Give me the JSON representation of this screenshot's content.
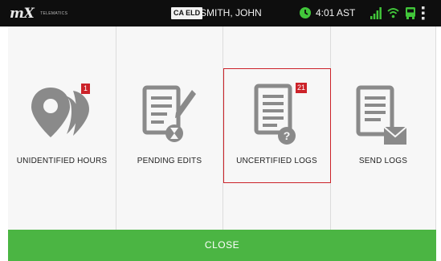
{
  "status_bar": {
    "logo_text": "mX",
    "logo_subtext": "TELEMATICS",
    "eld_badge": "CA ELD",
    "driver_name": "SMITH, JOHN",
    "time": "4:01 AST",
    "icons": [
      "clock-icon",
      "signal-icon",
      "wifi-icon",
      "truck-icon",
      "overflow-menu-icon"
    ],
    "accent_color": "#41c63a"
  },
  "tiles": [
    {
      "label": "UNIDENTIFIED HOURS",
      "badge": "1",
      "icon": "location-pin-icon"
    },
    {
      "label": "PENDING EDITS",
      "badge": "",
      "icon": "document-edit-icon"
    },
    {
      "label": "UNCERTIFIED LOGS",
      "badge": "21",
      "icon": "document-question-icon",
      "selected": true
    },
    {
      "label": "SEND LOGS",
      "badge": "",
      "icon": "document-mail-icon"
    }
  ],
  "close_button": {
    "label": "CLOSE",
    "color": "#4bb543"
  },
  "colors": {
    "badge": "#cc2229",
    "icon_gray": "#8a8a8a",
    "status_bar": "#0e0e0e"
  }
}
